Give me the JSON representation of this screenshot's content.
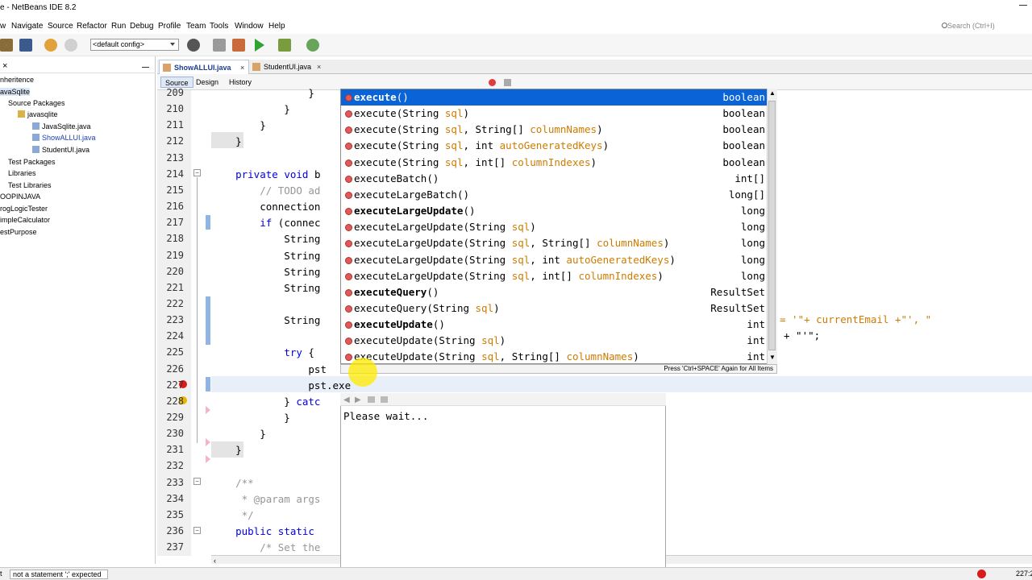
{
  "window": {
    "title": "e - NetBeans IDE 8.2"
  },
  "menu": [
    "w",
    "Navigate",
    "Source",
    "Refactor",
    "Run",
    "Debug",
    "Profile",
    "Team",
    "Tools",
    "Window",
    "Help"
  ],
  "search": {
    "placeholder": "Search (Ctrl+I)"
  },
  "toolbar": {
    "config": "<default config>"
  },
  "projects_tree": [
    {
      "label": "nheritence",
      "indent": 0,
      "selected": false
    },
    {
      "label": "avaSqlite",
      "indent": 0,
      "selected": true
    },
    {
      "label": "Source Packages",
      "indent": 1,
      "selected": false
    },
    {
      "label": "javasqlite",
      "indent": 2,
      "selected": false
    },
    {
      "label": "JavaSqlite.java",
      "indent": 3,
      "selected": false
    },
    {
      "label": "ShowALLUI.java",
      "indent": 3,
      "selected": false
    },
    {
      "label": "StudentUI.java",
      "indent": 3,
      "selected": false
    },
    {
      "label": "Test Packages",
      "indent": 1,
      "selected": false
    },
    {
      "label": "Libraries",
      "indent": 1,
      "selected": false
    },
    {
      "label": "Test Libraries",
      "indent": 1,
      "selected": false
    },
    {
      "label": "OOPINJAVA",
      "indent": 0,
      "selected": false
    },
    {
      "label": "rogLogicTester",
      "indent": 0,
      "selected": false
    },
    {
      "label": "impleCalculator",
      "indent": 0,
      "selected": false
    },
    {
      "label": "estPurpose",
      "indent": 0,
      "selected": false
    }
  ],
  "tabs": [
    {
      "label": "ShowALLUI.java",
      "active": true
    },
    {
      "label": "StudentUI.java",
      "active": false
    }
  ],
  "editor_tabs": [
    "Source",
    "Design",
    "History"
  ],
  "line_numbers": [
    "209",
    "210",
    "211",
    "212",
    "213",
    "214",
    "215",
    "216",
    "217",
    "218",
    "219",
    "220",
    "221",
    "222",
    "223",
    "224",
    "225",
    "226",
    "227",
    "228",
    "229",
    "230",
    "231",
    "232",
    "233",
    "234",
    "235",
    "236",
    "237"
  ],
  "code_lines": [
    {
      "text": "                }",
      "cls": ""
    },
    {
      "text": "            }",
      "cls": ""
    },
    {
      "text": "        }",
      "cls": ""
    },
    {
      "text": "    }",
      "cls": ""
    },
    {
      "text": "",
      "cls": ""
    },
    {
      "text": "    private void b",
      "cls": "kw-mix"
    },
    {
      "text": "        // TODO ad",
      "cls": "cm"
    },
    {
      "text": "        connection",
      "cls": ""
    },
    {
      "text": "        if (connec",
      "cls": "kw-if"
    },
    {
      "text": "            String",
      "cls": ""
    },
    {
      "text": "            String",
      "cls": ""
    },
    {
      "text": "            String",
      "cls": ""
    },
    {
      "text": "            String",
      "cls": ""
    },
    {
      "text": "",
      "cls": ""
    },
    {
      "text": "            String",
      "cls": ""
    },
    {
      "text": "",
      "cls": ""
    },
    {
      "text": "            try {",
      "cls": "kw-try"
    },
    {
      "text": "                pst",
      "cls": ""
    },
    {
      "text": "                pst.exe",
      "cls": ""
    },
    {
      "text": "            } catc",
      "cls": "kw-catch"
    },
    {
      "text": "            }",
      "cls": ""
    },
    {
      "text": "        }",
      "cls": ""
    },
    {
      "text": "    }",
      "cls": ""
    },
    {
      "text": "",
      "cls": ""
    },
    {
      "text": "    /**",
      "cls": "cm"
    },
    {
      "text": "     * @param args",
      "cls": "cm"
    },
    {
      "text": "     */",
      "cls": "cm"
    },
    {
      "text": "    public static",
      "cls": "kw-mix"
    },
    {
      "text": "        /* Set the",
      "cls": "cm"
    }
  ],
  "code_right": {
    "line_223": "= '\"+ currentEmail +\"', \"",
    "line_224": "+ \"'\";"
  },
  "completion": {
    "items": [
      {
        "name": "execute",
        "params": "()",
        "ret": "boolean",
        "bold": true
      },
      {
        "name": "execute",
        "params": "(String sql)",
        "ret": "boolean",
        "bold": false
      },
      {
        "name": "execute",
        "params": "(String sql, String[] columnNames)",
        "ret": "boolean",
        "bold": false
      },
      {
        "name": "execute",
        "params": "(String sql, int autoGeneratedKeys)",
        "ret": "boolean",
        "bold": false
      },
      {
        "name": "execute",
        "params": "(String sql, int[] columnIndexes)",
        "ret": "boolean",
        "bold": false
      },
      {
        "name": "executeBatch",
        "params": "()",
        "ret": "int[]",
        "bold": false
      },
      {
        "name": "executeLargeBatch",
        "params": "()",
        "ret": "long[]",
        "bold": false
      },
      {
        "name": "executeLargeUpdate",
        "params": "()",
        "ret": "long",
        "bold": true
      },
      {
        "name": "executeLargeUpdate",
        "params": "(String sql)",
        "ret": "long",
        "bold": false
      },
      {
        "name": "executeLargeUpdate",
        "params": "(String sql, String[] columnNames)",
        "ret": "long",
        "bold": false
      },
      {
        "name": "executeLargeUpdate",
        "params": "(String sql, int autoGeneratedKeys)",
        "ret": "long",
        "bold": false
      },
      {
        "name": "executeLargeUpdate",
        "params": "(String sql, int[] columnIndexes)",
        "ret": "long",
        "bold": false
      },
      {
        "name": "executeQuery",
        "params": "()",
        "ret": "ResultSet",
        "bold": true
      },
      {
        "name": "executeQuery",
        "params": "(String sql)",
        "ret": "ResultSet",
        "bold": false
      },
      {
        "name": "executeUpdate",
        "params": "()",
        "ret": "int",
        "bold": true
      },
      {
        "name": "executeUpdate",
        "params": "(String sql)",
        "ret": "int",
        "bold": false
      },
      {
        "name": "executeUpdate",
        "params": "(String sql, String[] columnNames)",
        "ret": "int",
        "bold": false
      }
    ],
    "hint": "Press 'Ctrl+SPACE' Again for All Items"
  },
  "doc_popup": {
    "text": "Please wait..."
  },
  "status": {
    "message": "not a statement  ';' expected",
    "position": "227:2",
    "left_char": "t"
  },
  "colors": {
    "selection": "#0a64d7",
    "keyword": "#0000e6",
    "string": "#ce7b00",
    "comment": "#969696",
    "error": "#d81b1b"
  },
  "icons": [
    "new-project-icon",
    "save-all-icon",
    "undo-icon",
    "redo-icon",
    "build-icon",
    "clean-build-icon",
    "run-icon",
    "debug-icon",
    "profile-icon",
    "close-icon",
    "error-icon",
    "warning-icon"
  ]
}
